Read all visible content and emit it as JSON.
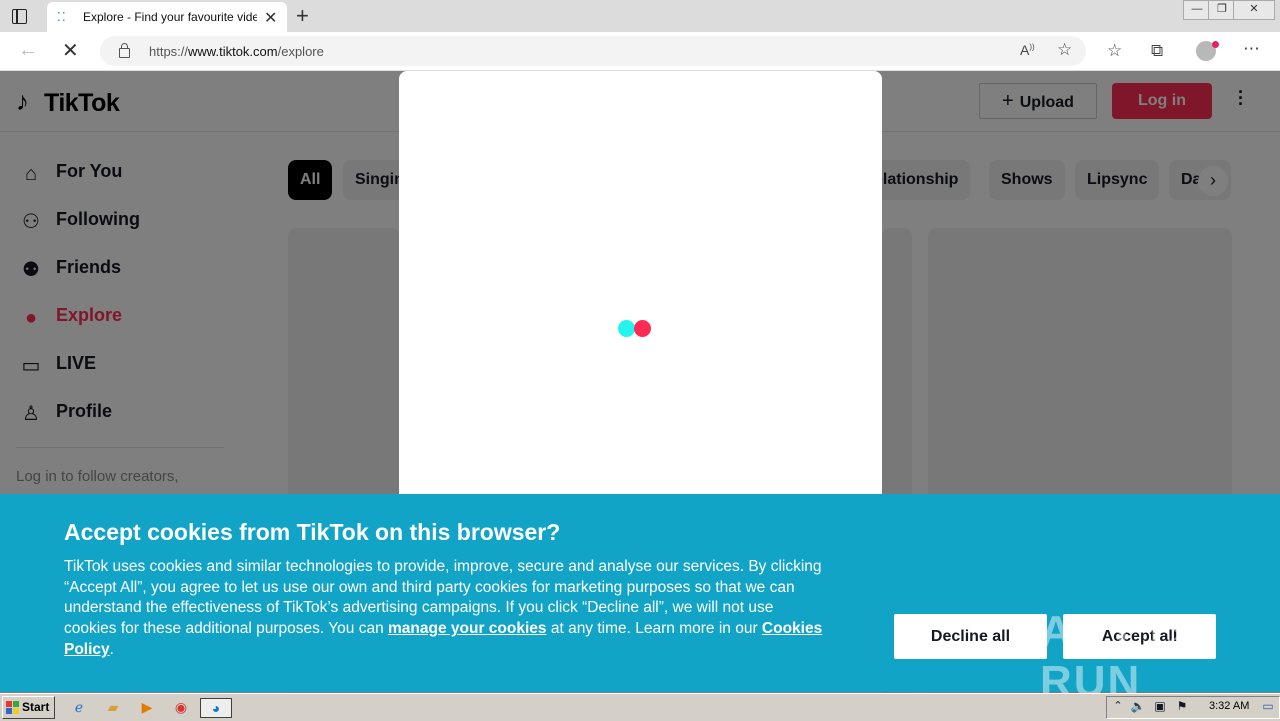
{
  "browser": {
    "tab_title": "Explore - Find your favourite vide",
    "tab_close": "✕",
    "new_tab": "+",
    "url_prefix": "https://",
    "url_host": "www.tiktok.com",
    "url_path": "/explore",
    "window_min": "—",
    "window_max": "❐",
    "window_close": "✕"
  },
  "header": {
    "logo_text": "TikTok",
    "upload_label": "Upload",
    "login_label": "Log in"
  },
  "sidebar": {
    "items": [
      {
        "label": "For You",
        "icon": "home-icon",
        "active": false
      },
      {
        "label": "Following",
        "icon": "following-icon",
        "active": false
      },
      {
        "label": "Friends",
        "icon": "friends-icon",
        "active": false
      },
      {
        "label": "Explore",
        "icon": "compass-icon",
        "active": true
      },
      {
        "label": "LIVE",
        "icon": "live-icon",
        "active": false
      },
      {
        "label": "Profile",
        "icon": "profile-icon",
        "active": false
      }
    ],
    "login_prompt": "Log in to follow creators,"
  },
  "categories": {
    "visible_left": [
      "All",
      "Singin"
    ],
    "visible_right": [
      "elationship",
      "Shows",
      "Lipsync",
      "Da"
    ]
  },
  "cookie": {
    "title": "Accept cookies from TikTok on this browser?",
    "body_1": "TikTok uses cookies and similar technologies to provide, improve, secure and analyse our services. By clicking “Accept All”, you agree to let us use our own and third party cookies for marketing purposes so that we can understand the effectiveness of TikTok’s advertising campaigns. If you click “Decline all”, we will not use cookies for these additional purposes. You can ",
    "manage_link": "manage your cookies",
    "body_2": " at any time. Learn more in our ",
    "policy_link": "Cookies Policy",
    "body_3": ".",
    "decline_label": "Decline all",
    "accept_label": "Accept all"
  },
  "watermark": "ANY ▷ RUN",
  "taskbar": {
    "start_label": "Start",
    "clock": "3:32 AM"
  },
  "colors": {
    "brand_red": "#fe2c55",
    "brand_cyan": "#25f4ee",
    "cookie_bg": "#12a4c7"
  }
}
